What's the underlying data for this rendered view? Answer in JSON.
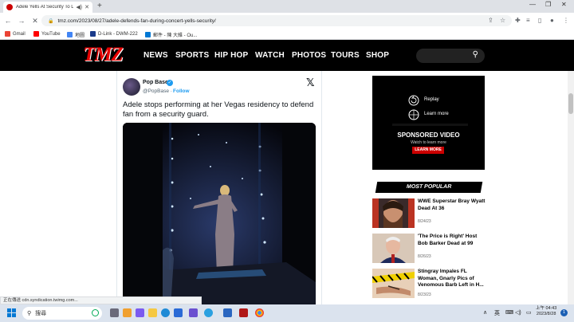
{
  "browser": {
    "tab_title": "Adele Yells At Security To L",
    "url": "tmz.com/2023/08/27/adele-defends-fan-during-concert-yells-security/",
    "bookmarks": [
      "Gmail",
      "YouTube",
      "地圖",
      "D-Link - DWM-222",
      "郵件 - 陳 大維 - Ou..."
    ],
    "status_text": "正在傳送 cdn.syndication.twimg.com..."
  },
  "site": {
    "logo": "TMZ",
    "nav": [
      "NEWS",
      "SPORTS",
      "HIP HOP",
      "WATCH",
      "PHOTOS",
      "TOURS",
      "SHOP"
    ]
  },
  "tweet": {
    "name": "Pop Base",
    "handle": "@PopBase",
    "follow": "Follow",
    "text": "Adele stops performing at her Vegas residency to defend fan from a security guard."
  },
  "ad": {
    "replay": "Replay",
    "learn_more_link": "Learn more",
    "sponsored": "SPONSORED VIDEO",
    "watch": "Watch to learn more",
    "cta": "LEARN MORE"
  },
  "most_popular": {
    "title": "MOST POPULAR",
    "items": [
      {
        "title": "WWE Superstar Bray Wyatt Dead At 36",
        "date": "8/24/23"
      },
      {
        "title": "'The Price is Right' Host Bob Barker Dead at 99",
        "date": "8/26/23"
      },
      {
        "title": "Stingray Impales FL Woman, Gnarly Pics of Venomous Barb Left in H...",
        "date": "8/23/23"
      }
    ]
  },
  "taskbar": {
    "search": "搜尋",
    "ime": "英",
    "time": "上午 04:43",
    "date": "2023/8/28",
    "notifications": "1"
  }
}
